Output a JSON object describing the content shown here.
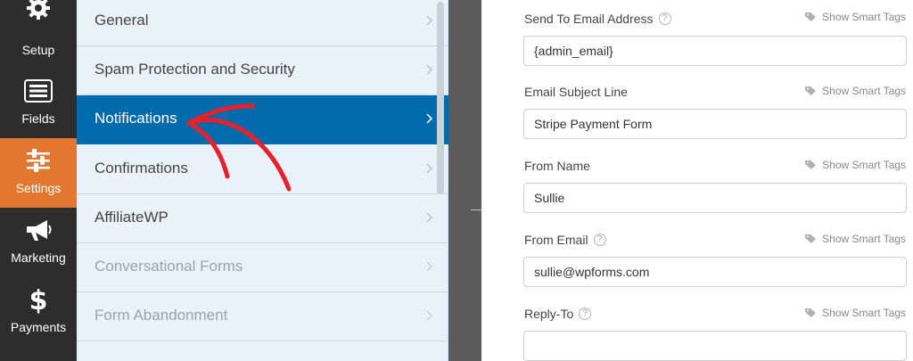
{
  "leftnav": {
    "items": [
      {
        "label": "Setup",
        "icon": "gear-icon"
      },
      {
        "label": "Fields",
        "icon": "fields-icon"
      },
      {
        "label": "Settings",
        "icon": "sliders-icon"
      },
      {
        "label": "Marketing",
        "icon": "megaphone-icon"
      },
      {
        "label": "Payments",
        "icon": "dollar-icon"
      }
    ],
    "active": "Settings",
    "accent": "#e27730"
  },
  "settings_menu": {
    "items": [
      {
        "label": "General"
      },
      {
        "label": "Spam Protection and Security"
      },
      {
        "label": "Notifications"
      },
      {
        "label": "Confirmations"
      },
      {
        "label": "AffiliateWP"
      },
      {
        "label": "Conversational Forms"
      },
      {
        "label": "Form Abandonment"
      }
    ],
    "active": "Notifications",
    "active_color": "#036aab"
  },
  "form": {
    "smart_tags_label": "Show Smart Tags",
    "fields": [
      {
        "label": "Send To Email Address",
        "value": ""
      },
      {
        "label": "Email Subject Line",
        "value": "Stripe Payment Form"
      },
      {
        "label": "From Name",
        "value": "Sullie"
      },
      {
        "label": "From Email",
        "value": "sullie@wpforms.com"
      },
      {
        "label": "Reply-To",
        "value": ""
      }
    ],
    "send_to_value": "{admin_email}",
    "help_icon": "?"
  },
  "annotation": {
    "arrow_color": "#e8202a"
  }
}
